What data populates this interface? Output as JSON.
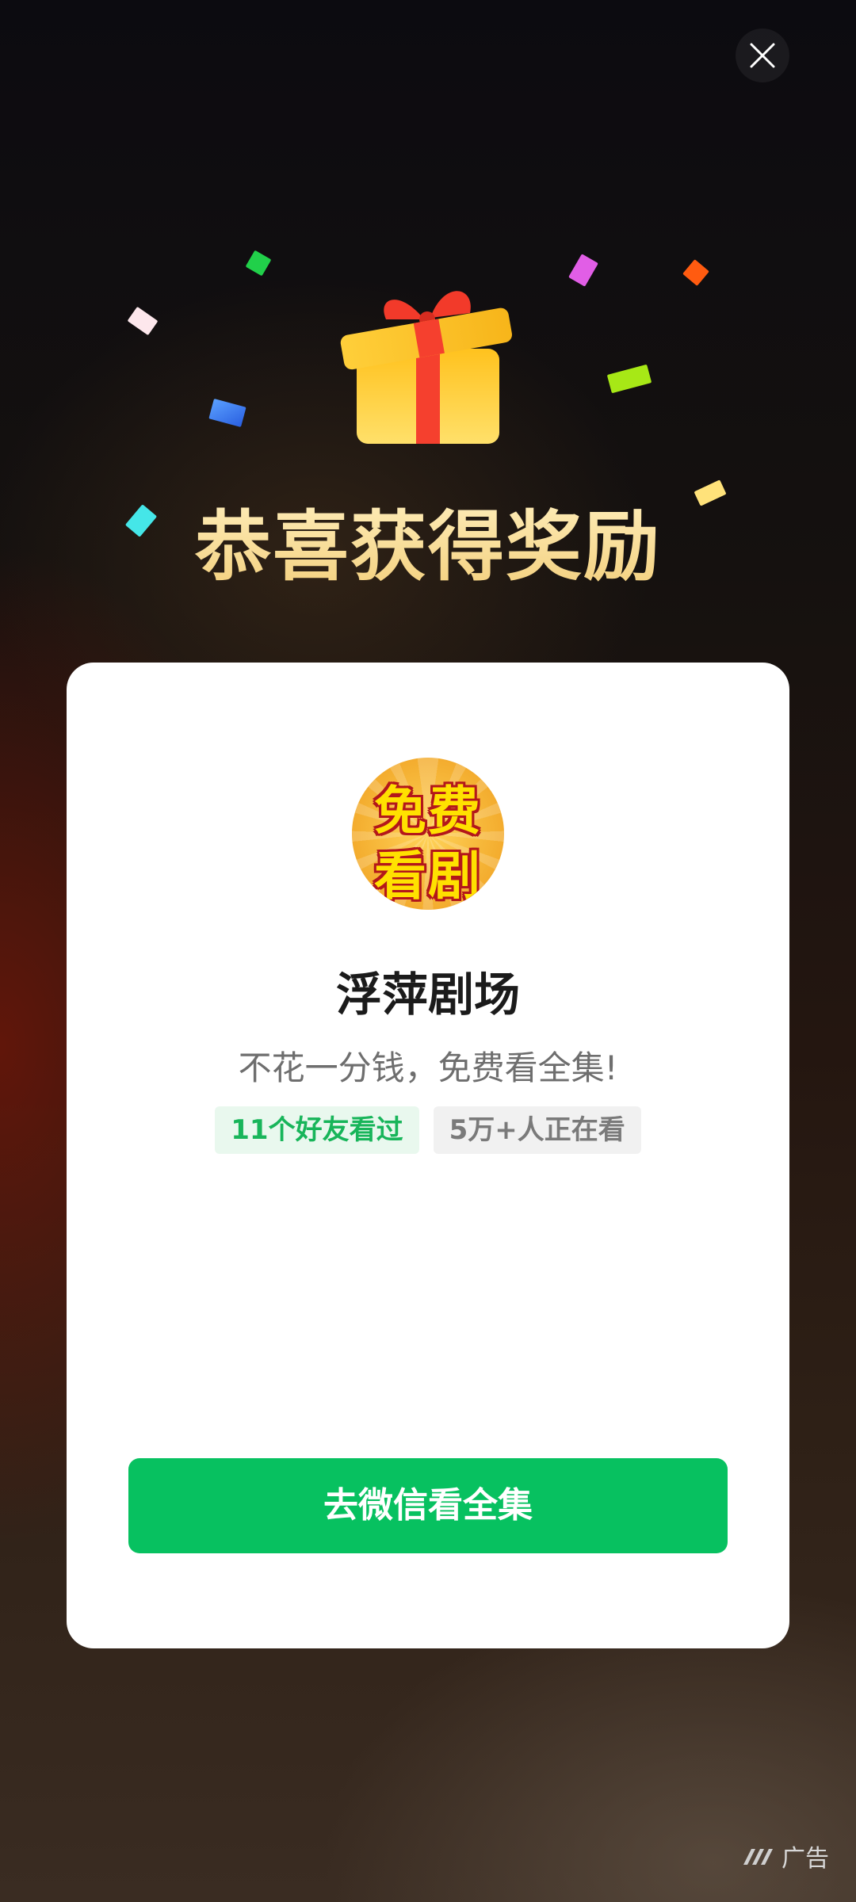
{
  "close": {
    "icon": "close-icon"
  },
  "header": {
    "title": "恭喜获得奖励",
    "gift_icon": "gift-box-icon",
    "colors": {
      "title": "#f3cf7c"
    }
  },
  "card": {
    "app_icon": {
      "name": "app-logo-icon",
      "lines": [
        "免费",
        "看剧"
      ]
    },
    "app_name": "浮萍剧场",
    "description": "不花一分钱，免费看全集!",
    "tags": [
      {
        "label": "11个好友看过",
        "color": "#18b55a"
      },
      {
        "label": "5万+人正在看",
        "color": "#7a7a7a"
      }
    ],
    "cta_label": "去微信看全集",
    "cta_color": "#07c160"
  },
  "ad_badge": {
    "icon": "ad-brand-icon",
    "label": "广告"
  }
}
